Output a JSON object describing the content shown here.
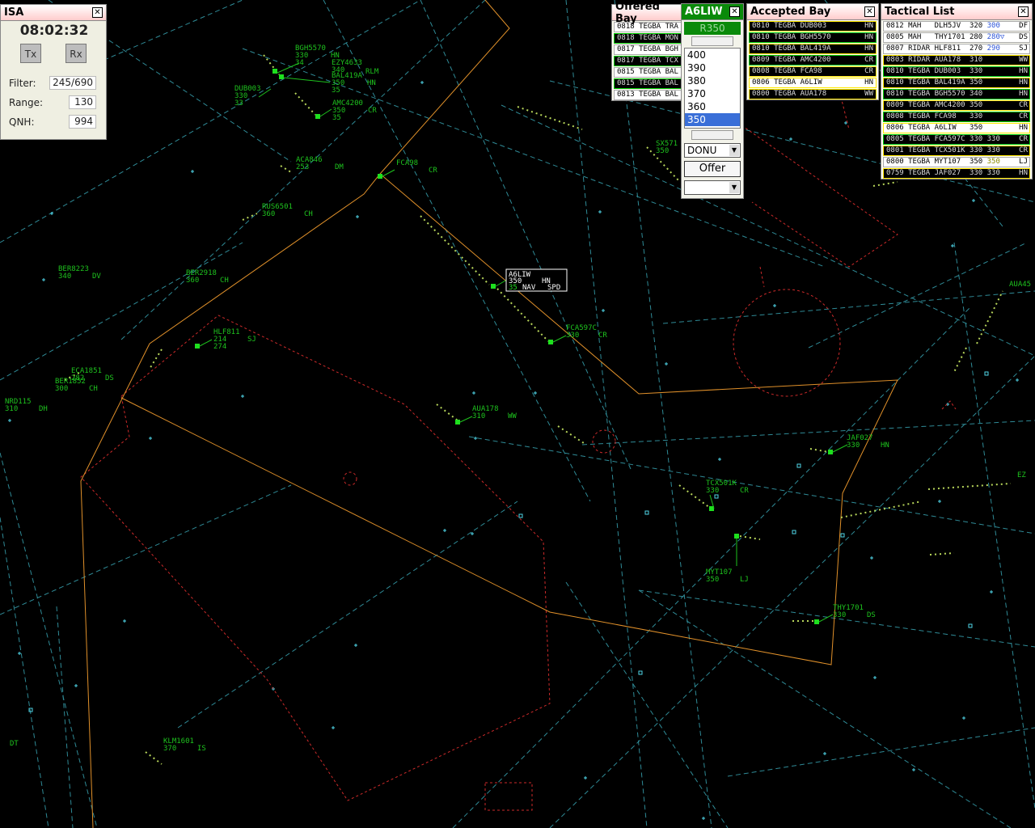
{
  "isa": {
    "title": "ISA",
    "close": "✕",
    "time": "08:02:32",
    "tx": "Tx",
    "rx": "Rx",
    "filter_label": "Filter:",
    "filter_value": "245/690",
    "range_label": "Range:",
    "range_value": "130",
    "qnh_label": "QNH:",
    "qnh_value": "994"
  },
  "offered_bay": {
    "title": "Offered Bay",
    "close": "✕",
    "strips": [
      "0818 TEGBA TRA",
      "0818 TEGBA MON",
      "0817 TEGBA BGH",
      "0817 TEGBA TCX",
      "0815 TEGBA BAL",
      "0815 TEGBA BAL",
      "0813 TEGBA BAL"
    ]
  },
  "aircraft_popup": {
    "callsign": "A6LIW",
    "close": "✕",
    "current_level": "R350",
    "levels": [
      "400",
      "390",
      "380",
      "370",
      "360",
      "350"
    ],
    "selected_level": "350",
    "route_select": "DONU",
    "offer_label": "Offer",
    "bottom_select": ""
  },
  "accepted_bay": {
    "title": "Accepted Bay",
    "close": "✕",
    "strips": [
      {
        "time": "0810",
        "unit": "TEGBA",
        "cs": "DUB003",
        "lvl": "",
        "sec": "HN"
      },
      {
        "time": "0810",
        "unit": "TEGBA",
        "cs": "BGH5570",
        "lvl": "",
        "sec": "HN"
      },
      {
        "time": "0810",
        "unit": "TEGBA",
        "cs": "BAL419A",
        "lvl": "",
        "sec": "HN"
      },
      {
        "time": "0809",
        "unit": "TEGBA",
        "cs": "AMC4200",
        "lvl": "",
        "sec": "CR"
      },
      {
        "time": "0808",
        "unit": "TEGBA",
        "cs": "FCA98",
        "lvl": "",
        "sec": "CR"
      },
      {
        "time": "0806",
        "unit": "TEGBA",
        "cs": "A6LIW",
        "lvl": "",
        "sec": "HN"
      },
      {
        "time": "0800",
        "unit": "TEGBA",
        "cs": "AUA178",
        "lvl": "",
        "sec": "WW"
      }
    ]
  },
  "tactical_list": {
    "title": "Tactical List",
    "close": "✕",
    "strips": [
      {
        "text": "0812 MAH   DLH5JV  320",
        "hl": "300",
        "sec": "DF"
      },
      {
        "text": "0805 MAH   THY1701 280",
        "hl": "280▽",
        "sec": "DS"
      },
      {
        "text": "0807 RIDAR HLF811  270",
        "hl": "290",
        "sec": "SJ"
      },
      {
        "text": "0803 RIDAR AUA178  310",
        "hl": "",
        "sec": "WW"
      },
      {
        "text": "0810 TEGBA DUB003  330",
        "hl": "",
        "sec": "HN"
      },
      {
        "text": "0810 TEGBA BAL419A 350",
        "hl": "",
        "sec": "HN"
      },
      {
        "text": "0810 TEGBA BGH5570 340",
        "hl": "",
        "sec": "HN"
      },
      {
        "text": "0809 TEGBA AMC4200 350",
        "hl": "",
        "sec": "CR"
      },
      {
        "text": "0808 TEGBA FCA98   330",
        "hl": "",
        "sec": "CR"
      },
      {
        "text": "0806 TEGBA A6LIW   350",
        "hl": "",
        "sec": "HN"
      },
      {
        "text": "0805 TEGBA FCA597C 330 330",
        "hl": "",
        "sec": "CR"
      },
      {
        "text": "0801 TEGBA TCX501K 330 330",
        "hl": "",
        "sec": "CR"
      },
      {
        "text": "0800 TEGBA MYT107  350",
        "hl": "350",
        "sec": "LJ"
      },
      {
        "text": "0759 TEGBA JAF027  330 330",
        "hl": "",
        "sec": "HN"
      }
    ]
  },
  "aircraft": [
    {
      "cs": "BGH5570",
      "l2": "330",
      "sec": "HN",
      "l3": "34"
    },
    {
      "cs": "EZY4633",
      "l2": "340",
      "sec": "",
      "l3": ""
    },
    {
      "cs": "BAL419A",
      "l2": "350",
      "sec": "HN",
      "l3": "35"
    },
    {
      "cs": "DUB003",
      "l2": "330",
      "sec": "",
      "l3": "33"
    },
    {
      "cs": "AMC4200",
      "l2": "350",
      "sec": "CR",
      "l3": "35"
    },
    {
      "cs": "ACA846",
      "l2": "253",
      "sec": "DM",
      "l3": ""
    },
    {
      "cs": "FCA98",
      "l2": "",
      "sec": "CR",
      "l3": ""
    },
    {
      "cs": "RUS6501",
      "l2": "360",
      "sec": "CH",
      "l3": ""
    },
    {
      "cs": "BER8223",
      "l2": "340",
      "sec": "DV",
      "l3": ""
    },
    {
      "cs": "BER2918",
      "l2": "360",
      "sec": "CH",
      "l3": ""
    },
    {
      "cs": "HLF811",
      "l2": "214",
      "sec": "SJ",
      "l3": "274"
    },
    {
      "cs": "ECA1851",
      "l2": "282",
      "sec": "DS",
      "l3": ""
    },
    {
      "cs": "BER1852",
      "l2": "300",
      "sec": "CH",
      "l3": ""
    },
    {
      "cs": "NRD115",
      "l2": "310",
      "sec": "DH",
      "l3": ""
    },
    {
      "cs": "FCA597C",
      "l2": "330",
      "sec": "CR",
      "l3": ""
    },
    {
      "cs": "AUA178",
      "l2": "310",
      "sec": "WW",
      "l3": ""
    },
    {
      "cs": "JAF027",
      "l2": "330",
      "sec": "HN",
      "l3": ""
    },
    {
      "cs": "TCX501K",
      "l2": "330",
      "sec": "CR",
      "l3": ""
    },
    {
      "cs": "MYT107",
      "l2": "350",
      "sec": "LJ",
      "l3": ""
    },
    {
      "cs": "THY1701",
      "l2": "330",
      "sec": "DS",
      "l3": ""
    },
    {
      "cs": "KLM1601",
      "l2": "370",
      "sec": "IS",
      "l3": ""
    },
    {
      "cs": "SX571",
      "l2": "350",
      "sec": "",
      "l3": ""
    },
    {
      "cs": "AUA45",
      "l2": "",
      "sec": "",
      "l3": ""
    },
    {
      "cs": "EZ",
      "l2": "",
      "sec": "",
      "l3": ""
    }
  ],
  "fixes": [
    "RLM"
  ],
  "edge_labels": [
    "DT"
  ],
  "selected_label": {
    "cs": "A6LIW",
    "l2": "350",
    "sec": "HN",
    "l3": "35",
    "nav": "NAV",
    "spd": "SPD"
  },
  "colors": {
    "airway": "#4fd6e8",
    "sector_orange": "#e0902a",
    "restricted_red": "#cc2a2a",
    "track_green": "#22dd22",
    "label_green": "#1ec21e",
    "window_bg": "#fffef2",
    "title_pink": "#ffcccc"
  }
}
